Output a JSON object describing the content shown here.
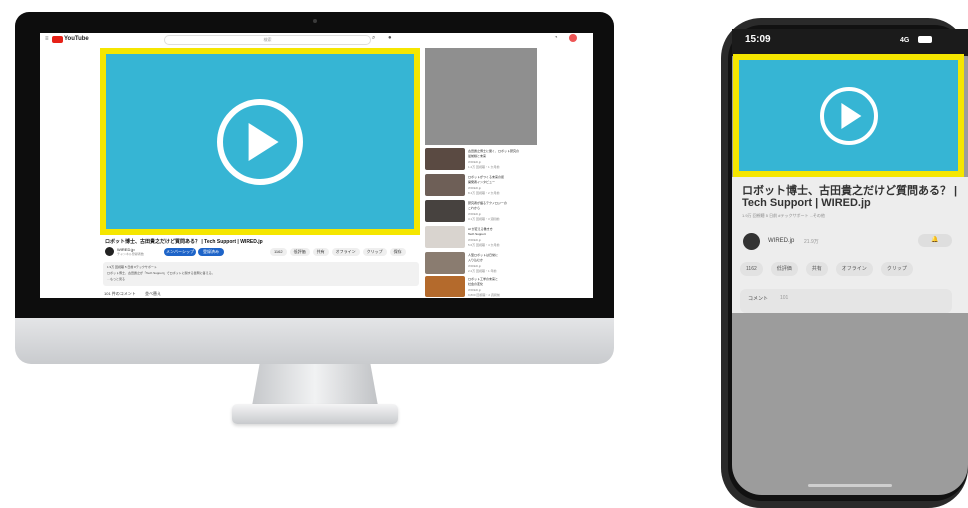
{
  "desktop": {
    "youtube": {
      "menu_icon": "hamburger-icon",
      "logo_text": "YouTube",
      "search_placeholder": "検索",
      "search_icon": "search-icon",
      "mic_icon": "mic-icon",
      "bell_icon": "bell-icon"
    },
    "video": {
      "play_icon": "play-icon",
      "highlight_color": "#f5e600",
      "placeholder_color": "#36b5d4",
      "title": "ロボット博士、古田貴之だけど質問ある？ | Tech Support | WIRED.jp",
      "channel_name": "WIRED.jp",
      "subscribers": "チャンネル登録者数",
      "join_label": "メンバーシップ",
      "subscribe_label": "登録済み",
      "actions": [
        "1162",
        "低評価",
        "共有",
        "オフライン",
        "クリップ",
        "保存"
      ],
      "description": [
        "1.9万 回視聴 5 日前 #テックサポート",
        "ロボット博士、古田貴之が「Tech Support」でロボットに関する質問に答える。",
        "…もっと見る"
      ],
      "comments_label": "101 件のコメント",
      "sort_label": "並べ替え"
    },
    "sidebar": [
      {
        "l1": "古田貴之博士に聞く、ロボット研究の",
        "l2": "最前線と未来",
        "l3": "WIRED.jp",
        "l4": "1.2万 回視聴・1 か月前",
        "thumb": "#5a4a42"
      },
      {
        "l1": "ロボットがつくる未来の街",
        "l2": "開発者インタビュー",
        "l3": "WIRED.jp",
        "l4": "8.4万 回視聴・2 か月前",
        "thumb": "#6e5f57"
      },
      {
        "l1": "研究者が語るテクノロジーの",
        "l2": "これから",
        "l3": "WIRED.jp",
        "l4": "3.1万 回視聴・3 週間前",
        "thumb": "#47423f"
      },
      {
        "l1": "AI が変える働き方",
        "l2": "Tech Support",
        "l3": "WIRED.jp",
        "l4": "5.6万 回視聴・4 か月前",
        "thumb": "#d9d4cf"
      },
      {
        "l1": "人型ロボットは日常に",
        "l2": "入り込むか",
        "l3": "WIRED.jp",
        "l4": "2.2万 回視聴・1 年前",
        "thumb": "#8a7c70"
      },
      {
        "l1": "ロボット工学の未来と",
        "l2": "社会の変化",
        "l3": "WIRED.jp",
        "l4": "9,800 回視聴・2 週間前",
        "thumb": "#b46a2c"
      }
    ]
  },
  "phone": {
    "time": "15:09",
    "network": "4G",
    "signal_icon": "signal-icon",
    "battery_icon": "battery-icon",
    "video": {
      "play_icon": "play-icon",
      "highlight_color": "#f5e600"
    },
    "title_line1": "ロボット博士、古田貴之だけど質問ある？ |",
    "title_line2": "Tech Support | WIRED.jp",
    "meta": "1.9万 回視聴 5 日前 #テックサポート ...その他",
    "channel_name": "WIRED.jp",
    "subscribers": "21.9万",
    "subscribe_icon": "bell-icon",
    "actions": [
      "1162",
      "低評価",
      "共有",
      "オフライン",
      "クリップ"
    ],
    "comments_label": "コメント",
    "comments_count": "101"
  }
}
